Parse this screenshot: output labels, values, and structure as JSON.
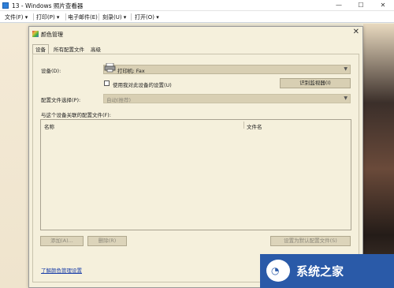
{
  "window": {
    "title": "13 - Windows 照片查看器",
    "minimize": "—",
    "maximize": "☐",
    "close": "✕"
  },
  "menubar": {
    "items": [
      "文件(F) ▾",
      "打印(P) ▾",
      "电子邮件(E)",
      "刻录(U) ▾",
      "打开(O) ▾"
    ]
  },
  "dialog": {
    "title": "颜色管理",
    "close": "✕",
    "tabs": [
      "设备",
      "所有配置文件",
      "高级"
    ],
    "active_tab": "设备",
    "device_label": "设备(D):",
    "device_value": "打印机: Fax",
    "use_my_settings_label": "使用我对此设备的设置(U)",
    "use_my_settings_checked": false,
    "identify_monitors_button": "识别监视器(I)",
    "profile_selection_label": "配置文件选择(P):",
    "profile_selection_value": "自动(推荐)",
    "associated_profiles_label": "与这个设备关联的配置文件(F):",
    "columns": [
      "名称",
      "文件名"
    ],
    "add_button": "添加(A)...",
    "remove_button": "删除(R)",
    "set_default_button": "设置为默认配置文件(S)",
    "understand_link": "了解颜色管理设置"
  },
  "watermark": {
    "logo_glyph": "◔",
    "text": "系统之家"
  }
}
